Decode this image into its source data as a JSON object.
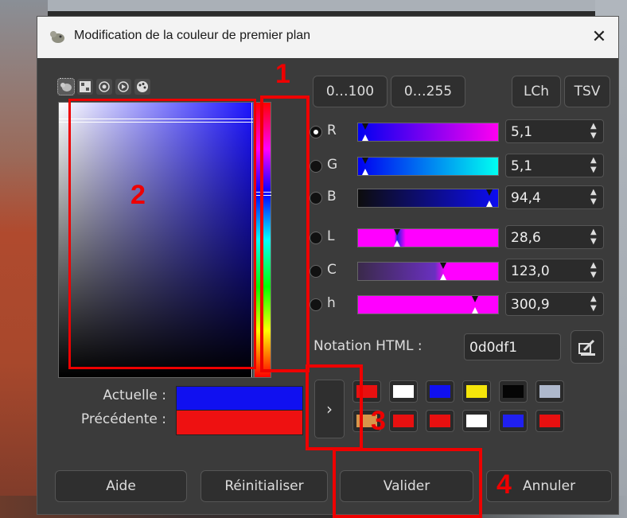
{
  "title": "Modification de la couleur de premier plan",
  "close_glyph": "✕",
  "selector_icons": [
    "gimp-icon",
    "cmyk-icon",
    "watercolor-icon",
    "wheel-icon",
    "palette-icon"
  ],
  "range_buttons": [
    "0…100",
    "0…255"
  ],
  "model_buttons": [
    "LCh",
    "TSV"
  ],
  "channels": [
    {
      "label": "R",
      "value": "5,1",
      "checked": true
    },
    {
      "label": "G",
      "value": "5,1",
      "checked": false
    },
    {
      "label": "B",
      "value": "94,4",
      "checked": false
    },
    {
      "label": "L",
      "value": "28,6",
      "checked": false
    },
    {
      "label": "C",
      "value": "123,0",
      "checked": false
    },
    {
      "label": "h",
      "value": "300,9",
      "checked": false
    }
  ],
  "html_label": "Notation HTML :",
  "html_value": "0d0df1",
  "current_label": "Actuelle :",
  "previous_label": "Précédente :",
  "current_color": "#1010f0",
  "previous_color": "#ee1111",
  "history_row1": [
    "#e81010",
    "#ffffff",
    "#1010f0",
    "#f5e50a",
    "#050505",
    "#aeb8cc"
  ],
  "history_row2": [
    "#d8964a",
    "#e81010",
    "#e81010",
    "#ffffff",
    "#2020f0",
    "#e81010"
  ],
  "buttons": {
    "help": "Aide",
    "reset": "Réinitialiser",
    "ok": "Valider",
    "cancel": "Annuler"
  },
  "annotations": [
    "1",
    "2",
    "3",
    "4"
  ]
}
